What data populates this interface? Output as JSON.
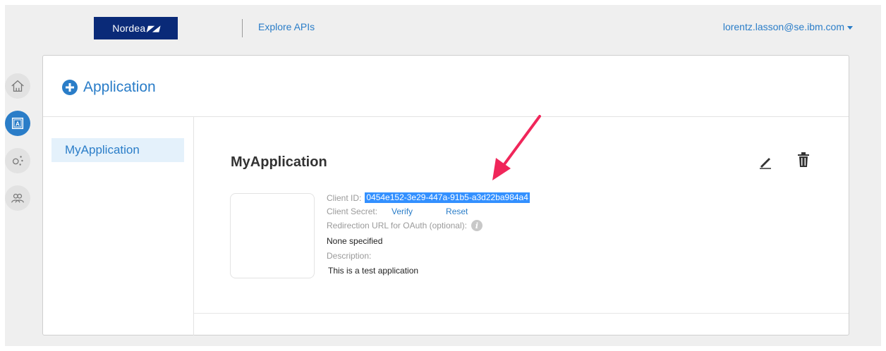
{
  "header": {
    "brand": "Nordea",
    "brand_mark": "◤◢",
    "nav_explore": "Explore APIs",
    "user_email": "lorentz.lasson@se.ibm.com"
  },
  "rail": {
    "items": [
      "home-icon",
      "apps-icon",
      "analytics-icon",
      "community-icon"
    ],
    "active": "apps-icon"
  },
  "card": {
    "add_label": "Application"
  },
  "sidebar": {
    "items": [
      {
        "label": "MyApplication"
      }
    ]
  },
  "detail": {
    "title": "MyApplication",
    "client_id_label": "Client ID:",
    "client_id_value": "0454e152-3e29-447a-91b5-a3d22ba984a4",
    "client_secret_label": "Client Secret:",
    "verify_label": "Verify",
    "reset_label": "Reset",
    "redirect_label": "Redirection URL for OAuth (optional):",
    "redirect_value": "None specified",
    "description_label": "Description:",
    "description_value": "This is a test application"
  },
  "colors": {
    "accent": "#2a7dc8",
    "brand": "#0a2a78",
    "annotation_arrow": "#f0265a",
    "selection": "#3390ff"
  }
}
